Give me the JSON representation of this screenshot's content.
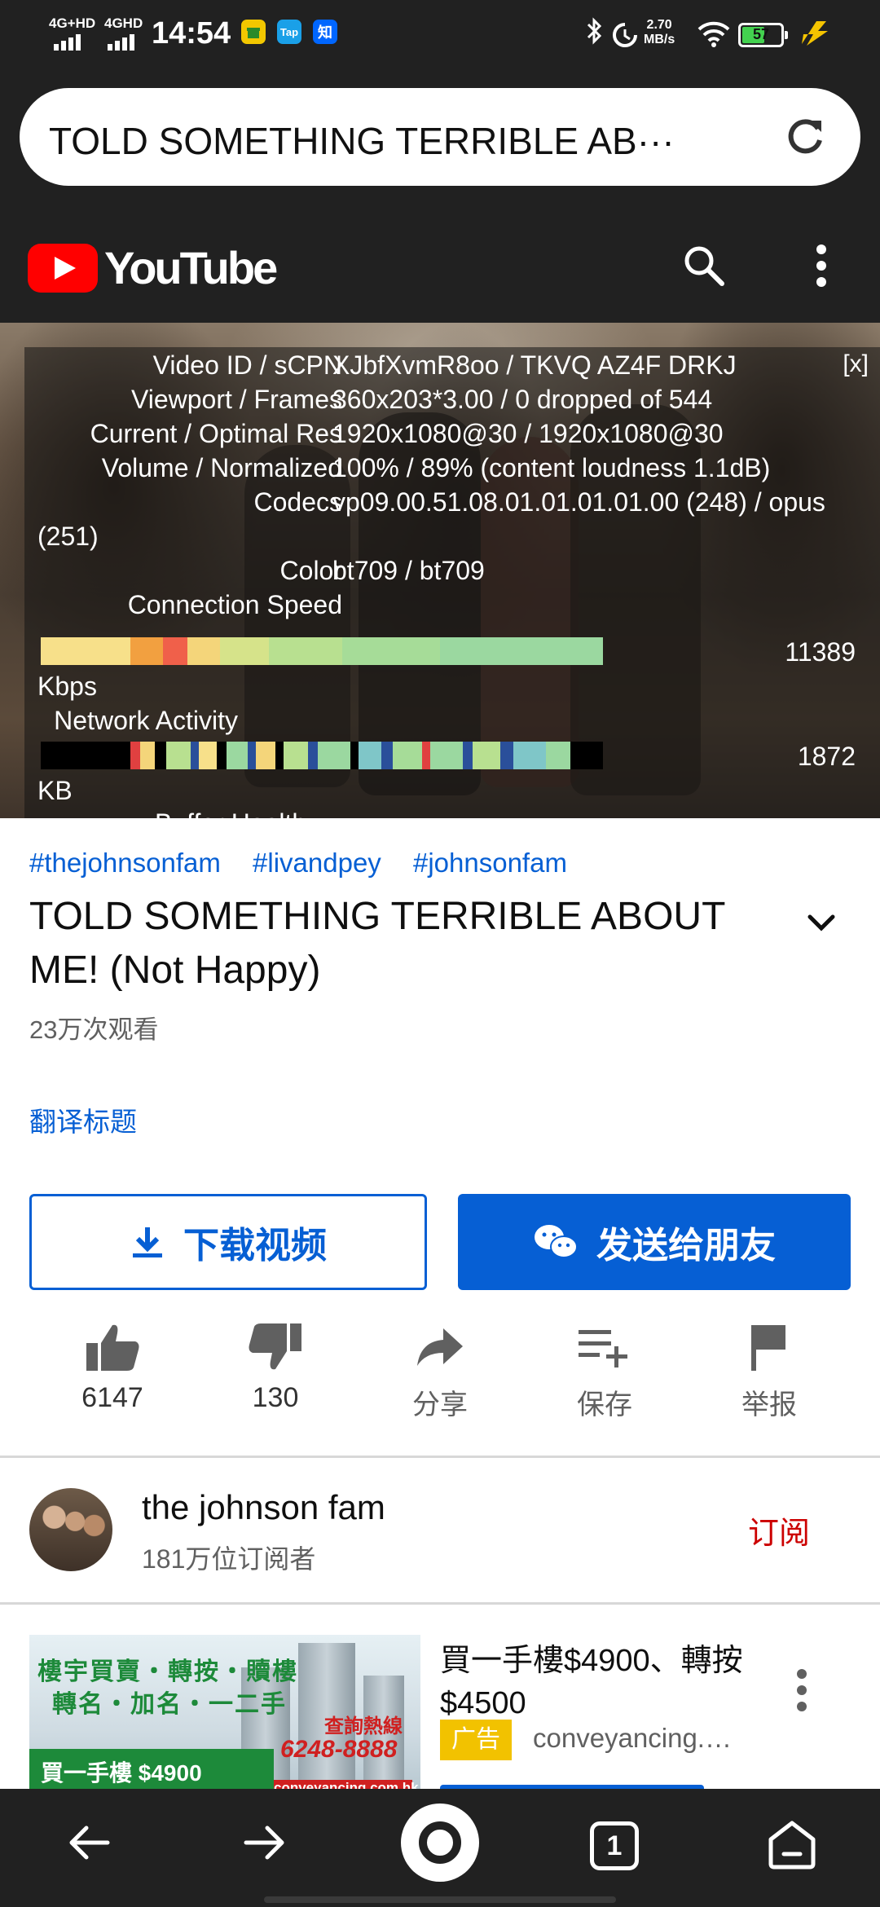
{
  "status_bar": {
    "net1": "4G+HD",
    "net2": "4GHD",
    "time": "14:54",
    "app_icons": [
      "gift-app-icon",
      "tap-app-icon",
      "zhi-app-icon"
    ],
    "tap_label": "Tap",
    "zhi_label": "知",
    "speed_value": "2.70",
    "speed_unit": "MB/s",
    "battery": "57"
  },
  "address_bar": {
    "url_text": "TOLD SOMETHING TERRIBLE AB···"
  },
  "youtube_header": {
    "logo_text": "YouTube"
  },
  "stats_for_nerds": {
    "close_label": "[x]",
    "rows": [
      {
        "key": "Video ID / sCPN",
        "value": "XJbfXvmR8oo / TKVQ AZ4F DRKJ"
      },
      {
        "key": "Viewport / Frames",
        "value": "360x203*3.00 / 0 dropped of 544"
      },
      {
        "key": "Current / Optimal Res",
        "value": "1920x1080@30 / 1920x1080@30"
      },
      {
        "key": "Volume / Normalized",
        "value": "100% / 89% (content loudness 1.1dB)"
      },
      {
        "key": "Codecs",
        "value": "vp09.00.51.08.01.01.01.01.00 (248) / opus"
      },
      {
        "key": "Color",
        "value": "bt709 / bt709"
      }
    ],
    "codecs_wrap": "(251)",
    "connection_label": "Connection Speed",
    "connection_value": "11389",
    "connection_unit": "Kbps",
    "network_label": "Network Activity",
    "network_value": "1872",
    "network_unit": "KB",
    "buffer_label": "Buffer Health"
  },
  "video_info": {
    "hashtags": [
      "#thejohnsonfam",
      "#livandpey",
      "#johnsonfam"
    ],
    "title": "TOLD SOMETHING TERRIBLE ABOUT ME! (Not Happy)",
    "views": "23万次观看",
    "translate_label": "翻译标题"
  },
  "buttons": {
    "download_label": "下载视频",
    "send_label": "发送给朋友"
  },
  "actions": {
    "like_count": "6147",
    "dislike_count": "130",
    "share_label": "分享",
    "save_label": "保存",
    "report_label": "举报"
  },
  "channel": {
    "name": "the johnson fam",
    "subscribers": "181万位订阅者",
    "subscribe_label": "订阅"
  },
  "ad": {
    "thumb_line1": "樓宇買賣・轉按・贖樓",
    "thumb_line2": "轉名・加名・一二手",
    "thumb_hotline": "查詢熱線",
    "thumb_phone": "6248-8888",
    "thumb_price": "買一手樓 $4900",
    "thumb_web": "conveyancing.com.hk",
    "title": "買一手樓$4900、轉按$4500",
    "badge": "广告",
    "domain": "conveyancing.…"
  },
  "colors": {
    "accent_blue": "#065fd4",
    "youtube_red": "#ff0000",
    "subscribe_red": "#cc0000",
    "ad_badge": "#f2c200",
    "dark_bar": "#212121"
  }
}
